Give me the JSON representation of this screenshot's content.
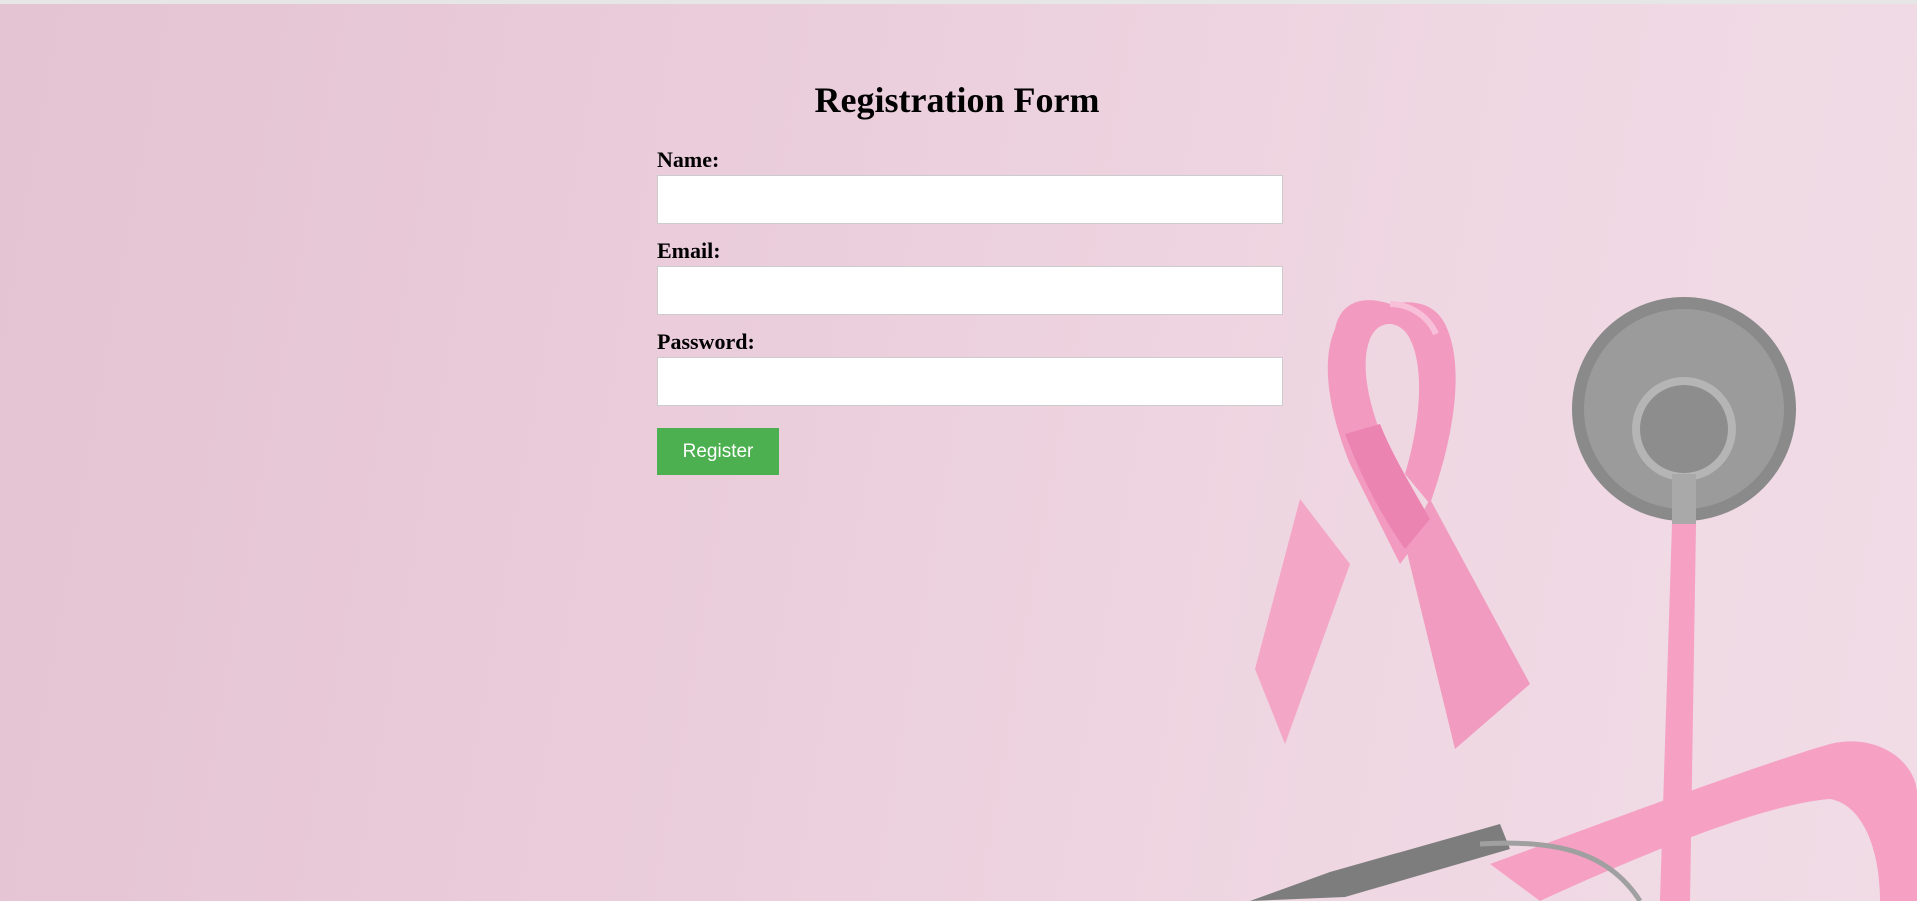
{
  "form": {
    "title": "Registration Form",
    "name_label": "Name:",
    "name_value": "",
    "email_label": "Email:",
    "email_value": "",
    "password_label": "Password:",
    "password_value": "",
    "submit_label": "Register"
  },
  "colors": {
    "background": "#eaccda",
    "button": "#4caf50",
    "button_text": "#ffffff",
    "ribbon": "#f29ac0",
    "stethoscope_metal": "#8a8a8a",
    "stethoscope_tube": "#f6a0c4"
  },
  "background_image": {
    "icons": [
      "pink-ribbon-icon",
      "stethoscope-icon"
    ]
  }
}
